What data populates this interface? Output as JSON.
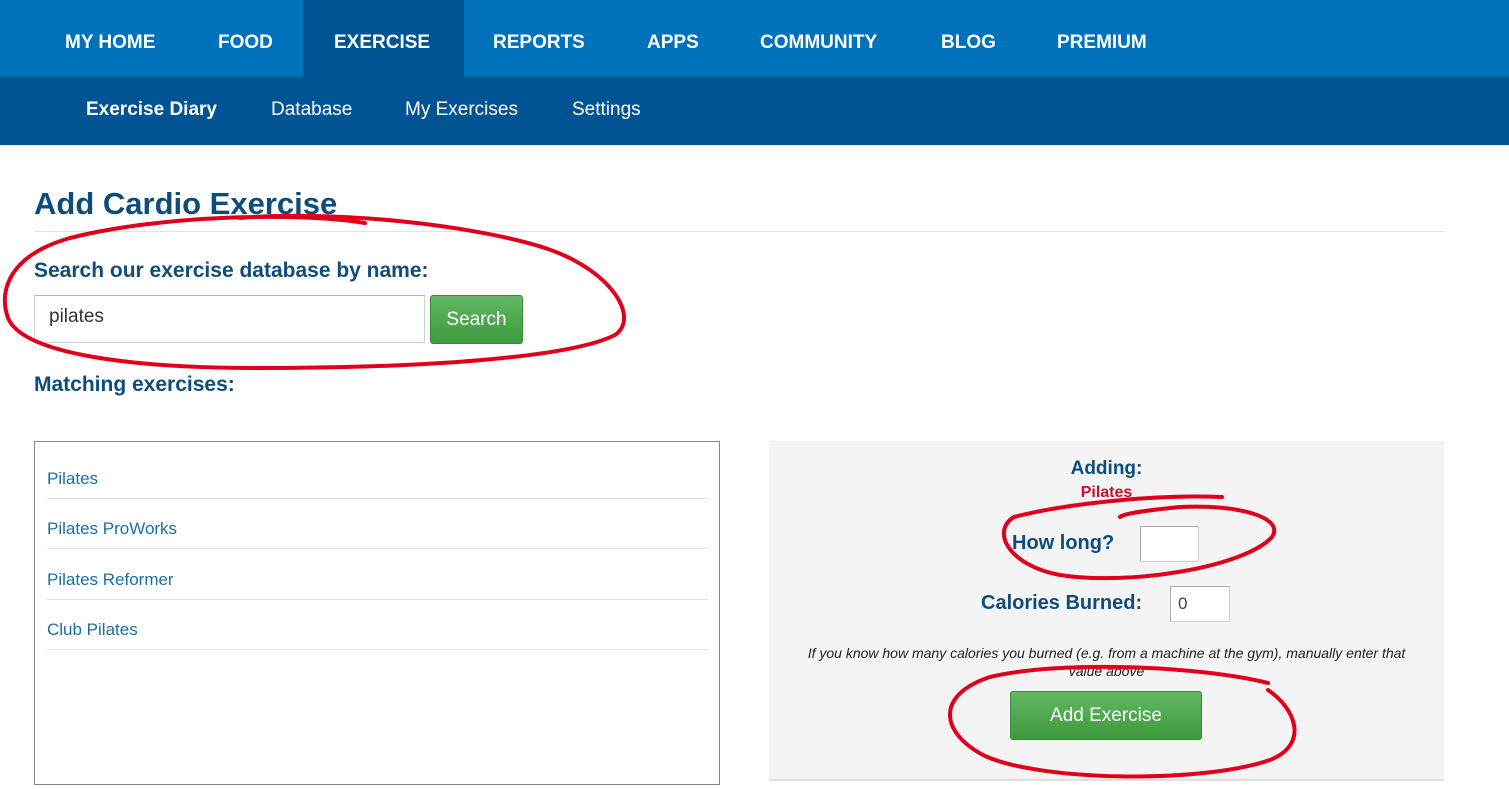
{
  "top_nav": {
    "items": [
      {
        "label": "MY HOME"
      },
      {
        "label": "FOOD"
      },
      {
        "label": "EXERCISE",
        "active": true
      },
      {
        "label": "REPORTS"
      },
      {
        "label": "APPS"
      },
      {
        "label": "COMMUNITY"
      },
      {
        "label": "BLOG"
      },
      {
        "label": "PREMIUM"
      }
    ]
  },
  "sub_nav": {
    "items": [
      {
        "label": "Exercise Diary",
        "active": true
      },
      {
        "label": "Database"
      },
      {
        "label": "My Exercises"
      },
      {
        "label": "Settings"
      }
    ]
  },
  "page": {
    "title": "Add Cardio Exercise",
    "search_label": "Search our exercise database by name:",
    "search_value": "pilates",
    "search_button": "Search",
    "matching_label": "Matching exercises:",
    "results": [
      "Pilates",
      "Pilates ProWorks",
      "Pilates Reformer",
      "Club Pilates"
    ]
  },
  "add_panel": {
    "adding_label": "Adding:",
    "exercise_name": "Pilates",
    "how_long_label": "How long?",
    "how_long_value": "",
    "calories_label": "Calories Burned:",
    "calories_value": "0",
    "hint": "If you know how many calories you burned (e.g. from a machine at the gym), manually enter that value above",
    "add_button": "Add Exercise"
  },
  "colors": {
    "nav_primary": "#0072bc",
    "nav_secondary": "#005494",
    "heading": "#0e4d7b",
    "link": "#1a6fa8",
    "button_green": "#4caf50",
    "exercise_name": "#c8102e",
    "annotation": "#e0001b"
  }
}
